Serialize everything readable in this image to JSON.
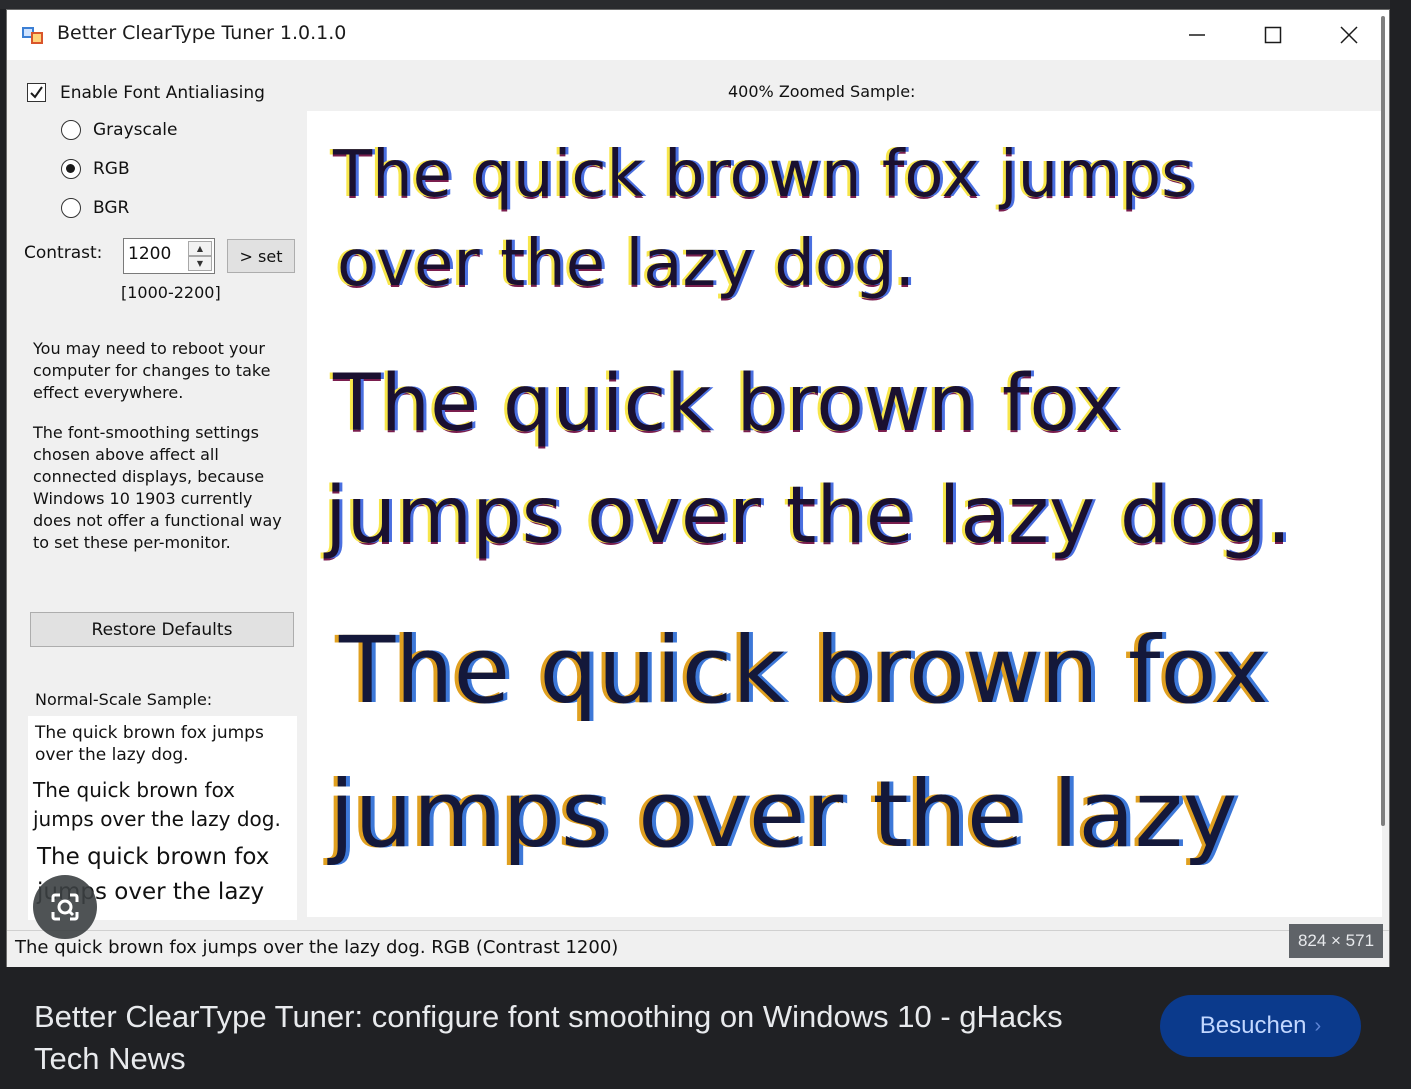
{
  "window": {
    "title": "Better ClearType Tuner 1.0.1.0"
  },
  "settings": {
    "enable_label": "Enable Font Antialiasing",
    "enable_checked": true,
    "modes": [
      {
        "label": "Grayscale",
        "selected": false
      },
      {
        "label": "RGB",
        "selected": true
      },
      {
        "label": "BGR",
        "selected": false
      }
    ],
    "contrast_label": "Contrast:",
    "contrast_value": "1200",
    "set_label": "> set",
    "contrast_range": "[1000-2200]"
  },
  "notes": {
    "reboot": "You may need to reboot your computer for changes to take effect everywhere.",
    "monitor": "The font-smoothing settings chosen above affect all connected displays, because Windows 10 1903 currently does not offer a functional way to set these per-monitor."
  },
  "restore_label": "Restore Defaults",
  "normal_sample": {
    "heading": "Normal-Scale Sample:",
    "line1": "The quick brown fox jumps over the lazy dog.",
    "line2": "The quick brown fox jumps over the lazy dog.",
    "line3": "The quick brown fox jumps over the lazy"
  },
  "zoom_sample": {
    "heading": "400% Zoomed Sample:",
    "lines": [
      "The quick brown fox jumps",
      "over the lazy dog.",
      "The quick brown fox",
      "jumps over the lazy dog.",
      "The quick brown fox",
      "jumps over the lazy"
    ]
  },
  "status_text": "The quick brown fox jumps over the lazy dog. RGB (Contrast 1200)",
  "image_dims": "824 × 571",
  "footer": {
    "title": "Better ClearType Tuner: configure font smoothing on Windows 10 - gHacks Tech News",
    "visit_label": "Besuchen"
  },
  "colors": {
    "accent_button": "#0b3a8c",
    "page_background": "#202124"
  }
}
